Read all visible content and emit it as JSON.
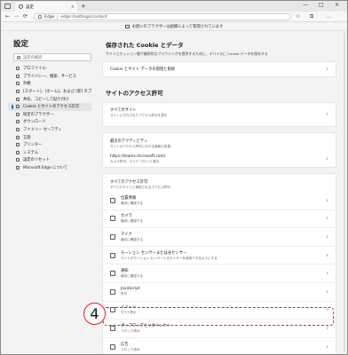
{
  "browser": {
    "tab_title": "設定",
    "tab_close": "×",
    "new_tab": "+",
    "window_controls": [
      "—",
      "□",
      "×"
    ],
    "nav": [
      "←",
      "→",
      "⟳"
    ],
    "address_label": "Edge",
    "address_url": "edge://settings/content",
    "toolbar_icons": [
      "☆",
      "⧉",
      "…"
    ],
    "managed_banner": "お使いのブラウザーは組織によって管理されています"
  },
  "sidebar": {
    "title": "設定",
    "search_placeholder": "設定の検索",
    "items": [
      {
        "label": "プロファイル",
        "icon": "profile-icon"
      },
      {
        "label": "プライバシー、検索、サービス",
        "icon": "lock-icon"
      },
      {
        "label": "外観",
        "icon": "appearance-icon"
      },
      {
        "label": "[スタート]、[ホーム]、および [新] タブ",
        "icon": "home-icon"
      },
      {
        "label": "共有、コピーして貼り付け",
        "icon": "share-icon"
      },
      {
        "label": "Cookie とサイトのアクセス許可",
        "icon": "cookie-icon",
        "active": true
      },
      {
        "label": "既定のブラウザー",
        "icon": "browser-icon"
      },
      {
        "label": "ダウンロード",
        "icon": "download-icon"
      },
      {
        "label": "ファミリー セーフティ",
        "icon": "family-icon"
      },
      {
        "label": "言語",
        "icon": "language-icon"
      },
      {
        "label": "プリンター",
        "icon": "printer-icon"
      },
      {
        "label": "システム",
        "icon": "system-icon"
      },
      {
        "label": "設定のリセット",
        "icon": "reset-icon"
      },
      {
        "label": "Microsoft Edge について",
        "icon": "edge-icon"
      }
    ]
  },
  "main": {
    "cookie_section": {
      "title": "保存された Cookie とデータ",
      "desc": "サイトとセッション間で継続的なブラウジングを提供するために、デバイスに Cookie データを保存する",
      "row": "Cookie とサイト データの管理と削除"
    },
    "perm_section": {
      "title": "サイトのアクセス許可",
      "all_sites": {
        "label": "すべてのサイト",
        "sub": "サイトに付与されたアクセス許可を表示"
      },
      "recent": {
        "label": "最近のアクティビティ",
        "sub": "サイトのアクセス許可に対する最新の変更",
        "site": "https://teams.microsoft.com/",
        "site_sub": "カメラ許可、マイク ブロック済み"
      },
      "all_perms_title": "すべてのアクセス許可",
      "all_perms_sub": "すべてのサイトに適用されるアクセス許可",
      "perms": [
        {
          "label": "位置情報",
          "sub": "最初に確認する",
          "icon": "location-icon"
        },
        {
          "label": "カメラ",
          "sub": "最初に確認する",
          "icon": "camera-icon"
        },
        {
          "label": "マイク",
          "sub": "最初に確認する",
          "icon": "microphone-icon"
        },
        {
          "label": "モーション センサーまたは光センサー",
          "sub": "サイトがモーション センサーと光センサーを使用できるようにする",
          "icon": "sensor-icon"
        },
        {
          "label": "通知",
          "sub": "最初に確認する",
          "icon": "bell-icon"
        },
        {
          "label": "JavaScript",
          "sub": "許可",
          "icon": "code-icon"
        },
        {
          "label": "イメージ",
          "sub": "すべて表示",
          "icon": "image-icon"
        },
        {
          "label": "ポップアップとリダイレクト",
          "sub": "ブロック済み",
          "icon": "popup-icon"
        },
        {
          "label": "広告",
          "sub": "ブロック済み",
          "icon": "ads-icon"
        }
      ]
    }
  },
  "annotation": {
    "number": "4",
    "color": "#e81e1e"
  },
  "chevron": "›"
}
